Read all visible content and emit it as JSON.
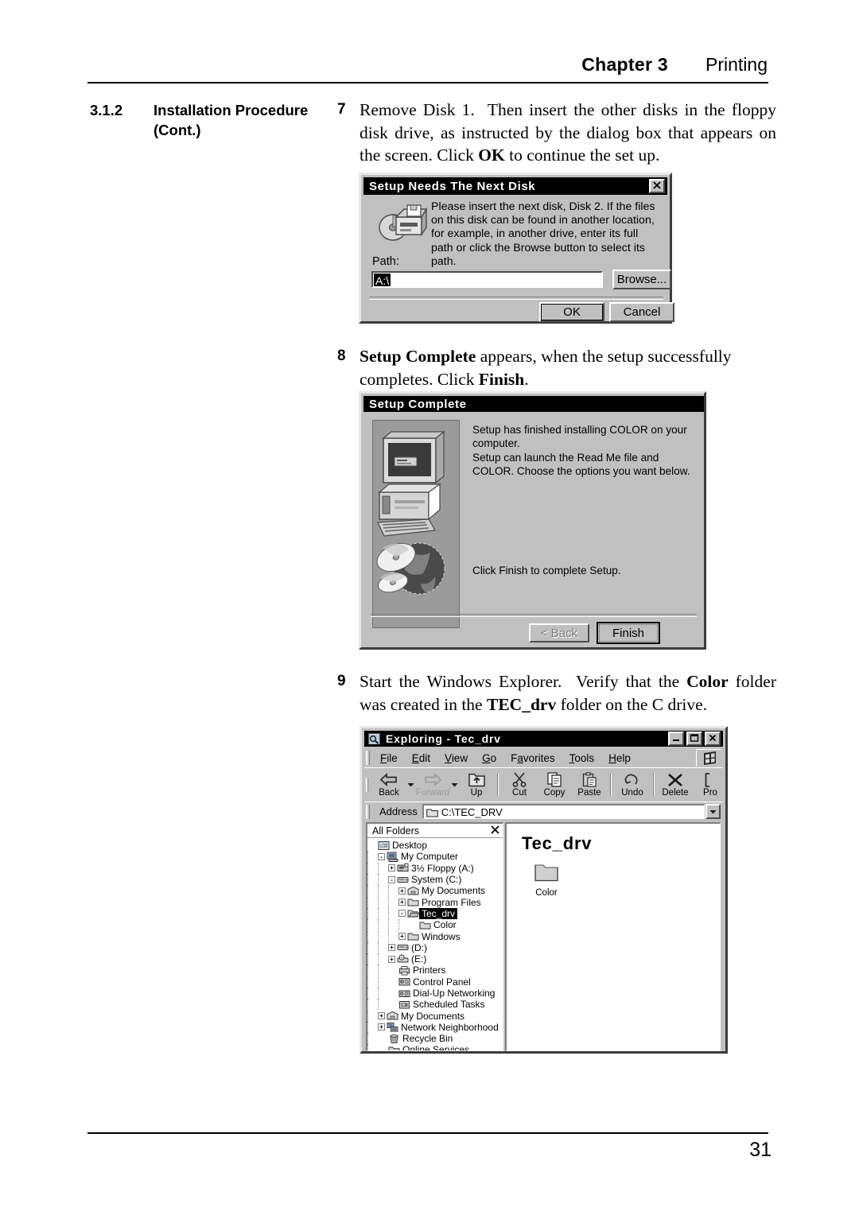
{
  "header": {
    "chapter": "Chapter 3",
    "section": "Printing"
  },
  "footer": {
    "page_number": "31"
  },
  "side_heading": {
    "number": "3.1.2",
    "title": "Installation Procedure (Cont.)"
  },
  "steps": [
    {
      "number": "7",
      "text_plain": "Remove Disk 1. Then insert the other disks in the floppy disk drive, as instructed by the dialog box that appears on the screen. Click OK to continue the set up.",
      "bold_terms": [
        "OK"
      ]
    },
    {
      "number": "8",
      "text_plain": "Setup Complete appears, when the setup successfully completes. Click Finish.",
      "bold_terms": [
        "Setup Complete",
        "Finish"
      ]
    },
    {
      "number": "9",
      "text_plain": "Start the Windows Explorer. Verify that the Color folder was created in the TEC_drv folder on the C drive.",
      "bold_terms": [
        "Color",
        "TEC_drv"
      ]
    }
  ],
  "dialog_next_disk": {
    "title": "Setup Needs The Next Disk",
    "close_label": "✕",
    "message": "Please insert the next disk, Disk 2. If the files on this disk can be found in another location, for example, in another drive, enter its full path or click the Browse button to select its path.",
    "path_label": "Path:",
    "path_value": "A:\\",
    "browse_label": "Browse...",
    "ok_label": "OK",
    "cancel_label": "Cancel"
  },
  "dialog_setup_complete": {
    "title": "Setup Complete",
    "line1": "Setup has finished installing COLOR on your computer.",
    "line2": "Setup can launch the Read Me file and COLOR.  Choose the options you want below.",
    "line3": "Click Finish to complete Setup.",
    "back_label": "< Back",
    "finish_label": "Finish"
  },
  "explorer": {
    "title": "Exploring - Tec_drv",
    "window_buttons": {
      "minimize": "–",
      "maximize": "❐",
      "close": "✕"
    },
    "menu": [
      {
        "label": "File",
        "accel": "F"
      },
      {
        "label": "Edit",
        "accel": "E"
      },
      {
        "label": "View",
        "accel": "V"
      },
      {
        "label": "Go",
        "accel": "G"
      },
      {
        "label": "Favorites",
        "accel": "a"
      },
      {
        "label": "Tools",
        "accel": "T"
      },
      {
        "label": "Help",
        "accel": "H"
      }
    ],
    "toolbar": [
      {
        "label": "Back",
        "icon": "back-arrow-icon",
        "dropdown": true,
        "disabled": false
      },
      {
        "label": "Forward",
        "icon": "forward-arrow-icon",
        "dropdown": true,
        "disabled": true
      },
      {
        "label": "Up",
        "icon": "up-folder-icon",
        "dropdown": false,
        "disabled": false
      },
      {
        "label": "Cut",
        "icon": "scissors-icon",
        "dropdown": false,
        "disabled": false
      },
      {
        "label": "Copy",
        "icon": "copy-icon",
        "dropdown": false,
        "disabled": false
      },
      {
        "label": "Paste",
        "icon": "clipboard-icon",
        "dropdown": false,
        "disabled": false
      },
      {
        "label": "Undo",
        "icon": "undo-arrow-icon",
        "dropdown": false,
        "disabled": false
      },
      {
        "label": "Delete",
        "icon": "x-delete-icon",
        "dropdown": false,
        "disabled": false
      },
      {
        "label": "Pro",
        "icon": "properties-icon",
        "dropdown": false,
        "disabled": false
      }
    ],
    "address": {
      "label": "Address",
      "value": "C:\\TEC_DRV"
    },
    "tree_header": {
      "label": "All Folders",
      "close": "✕"
    },
    "tree": [
      {
        "label": "Desktop",
        "indent": 0,
        "expander": "",
        "icon": "desktop-icon",
        "selected": false
      },
      {
        "label": "My Computer",
        "indent": 1,
        "expander": "-",
        "icon": "computer-icon",
        "selected": false
      },
      {
        "label": "3½ Floppy (A:)",
        "indent": 2,
        "expander": "+",
        "icon": "floppy-icon",
        "selected": false
      },
      {
        "label": "System (C:)",
        "indent": 2,
        "expander": "-",
        "icon": "harddrive-icon",
        "selected": false
      },
      {
        "label": "My Documents",
        "indent": 3,
        "expander": "+",
        "icon": "mydocs-icon",
        "selected": false
      },
      {
        "label": "Program Files",
        "indent": 3,
        "expander": "+",
        "icon": "folder-icon",
        "selected": false
      },
      {
        "label": "Tec_drv",
        "indent": 3,
        "expander": "-",
        "icon": "folder-open-icon",
        "selected": true
      },
      {
        "label": "Color",
        "indent": 4,
        "expander": "",
        "icon": "folder-icon",
        "selected": false
      },
      {
        "label": "Windows",
        "indent": 3,
        "expander": "+",
        "icon": "folder-icon",
        "selected": false
      },
      {
        "label": "(D:)",
        "indent": 2,
        "expander": "+",
        "icon": "harddrive-icon",
        "selected": false
      },
      {
        "label": "(E:)",
        "indent": 2,
        "expander": "+",
        "icon": "cdrom-icon",
        "selected": false
      },
      {
        "label": "Printers",
        "indent": 2,
        "expander": "",
        "icon": "printers-icon",
        "selected": false
      },
      {
        "label": "Control Panel",
        "indent": 2,
        "expander": "",
        "icon": "controlpanel-icon",
        "selected": false
      },
      {
        "label": "Dial-Up Networking",
        "indent": 2,
        "expander": "",
        "icon": "dialup-icon",
        "selected": false
      },
      {
        "label": "Scheduled Tasks",
        "indent": 2,
        "expander": "",
        "icon": "scheduled-icon",
        "selected": false
      },
      {
        "label": "My Documents",
        "indent": 1,
        "expander": "+",
        "icon": "mydocs-icon",
        "selected": false
      },
      {
        "label": "Network Neighborhood",
        "indent": 1,
        "expander": "+",
        "icon": "network-icon",
        "selected": false
      },
      {
        "label": "Recycle Bin",
        "indent": 1,
        "expander": "",
        "icon": "recyclebin-icon",
        "selected": false
      },
      {
        "label": "Online Services",
        "indent": 1,
        "expander": "",
        "icon": "folder-icon",
        "selected": false
      }
    ],
    "content": {
      "heading": "Tec_drv",
      "items": [
        {
          "label": "Color",
          "icon": "folder-icon"
        }
      ]
    }
  }
}
